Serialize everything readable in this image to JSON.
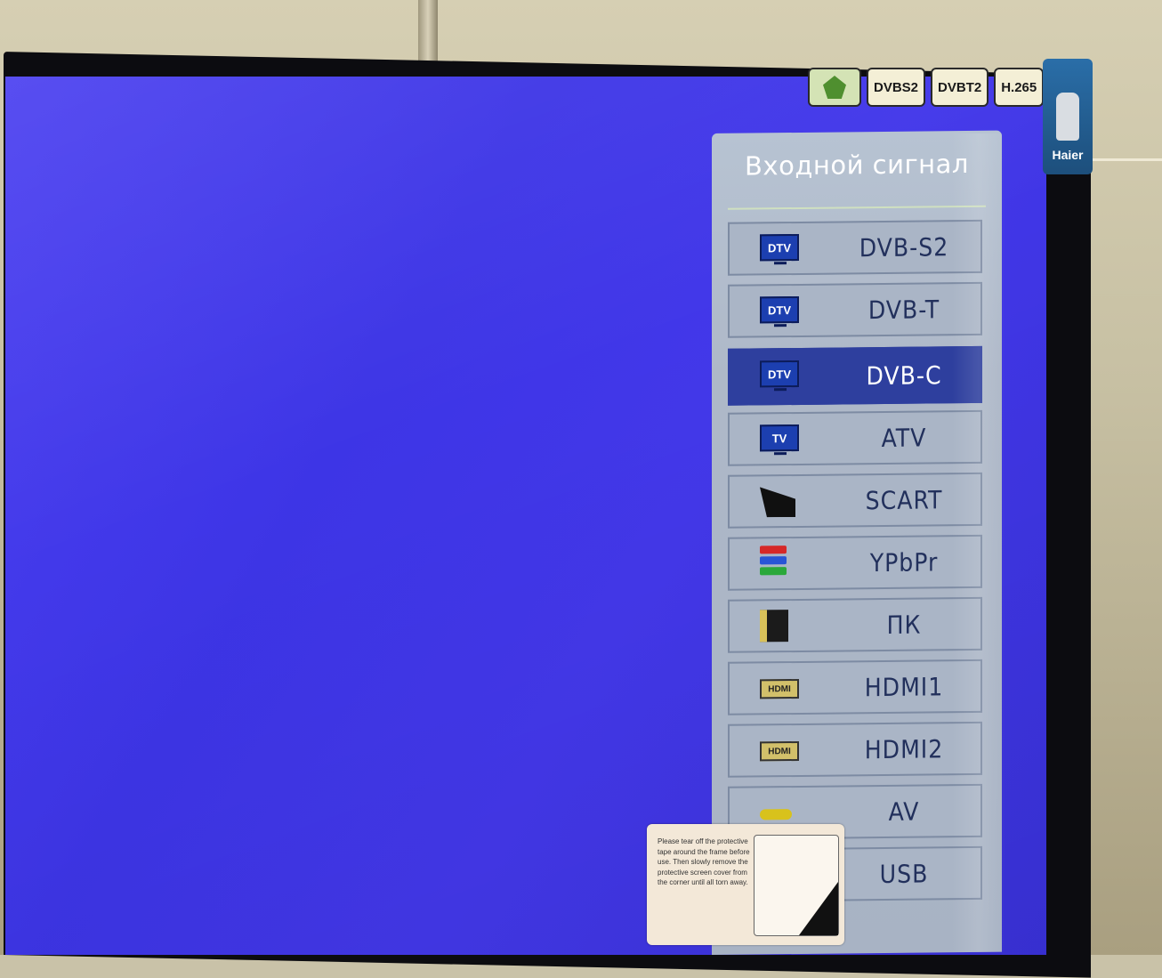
{
  "menu": {
    "title": "Входной сигнал",
    "selected_index": 2,
    "items": [
      {
        "label": "DVB-S2",
        "icon": "dtv-icon",
        "icon_text": "DTV"
      },
      {
        "label": "DVB-T",
        "icon": "dtv-icon",
        "icon_text": "DTV"
      },
      {
        "label": "DVB-C",
        "icon": "dtv-icon",
        "icon_text": "DTV"
      },
      {
        "label": "ATV",
        "icon": "tv-icon",
        "icon_text": "TV"
      },
      {
        "label": "SCART",
        "icon": "scart-icon"
      },
      {
        "label": "YPbPr",
        "icon": "component-rca-icon"
      },
      {
        "label": "ПК",
        "icon": "vga-connector-icon"
      },
      {
        "label": "HDMI1",
        "icon": "hdmi-icon",
        "icon_text": "HDMI"
      },
      {
        "label": "HDMI2",
        "icon": "hdmi-icon",
        "icon_text": "HDMI"
      },
      {
        "label": "AV",
        "icon": "rca-yellow-icon"
      },
      {
        "label": "USB",
        "icon": "usb-icon"
      }
    ]
  },
  "stickers": {
    "dvbs2": "DVBS2",
    "dvbt2": "DVBT2",
    "h265": "H.265",
    "brand": "Haier"
  },
  "warning": {
    "text": "Please tear off the protective tape around the frame before use. Then slowly remove the protective screen cover from the corner until all torn away."
  },
  "colors": {
    "screen": "#4139e8",
    "menu_panel": "#aeb8c8",
    "selected": "#2e3f9e",
    "item_text": "#22305c"
  }
}
